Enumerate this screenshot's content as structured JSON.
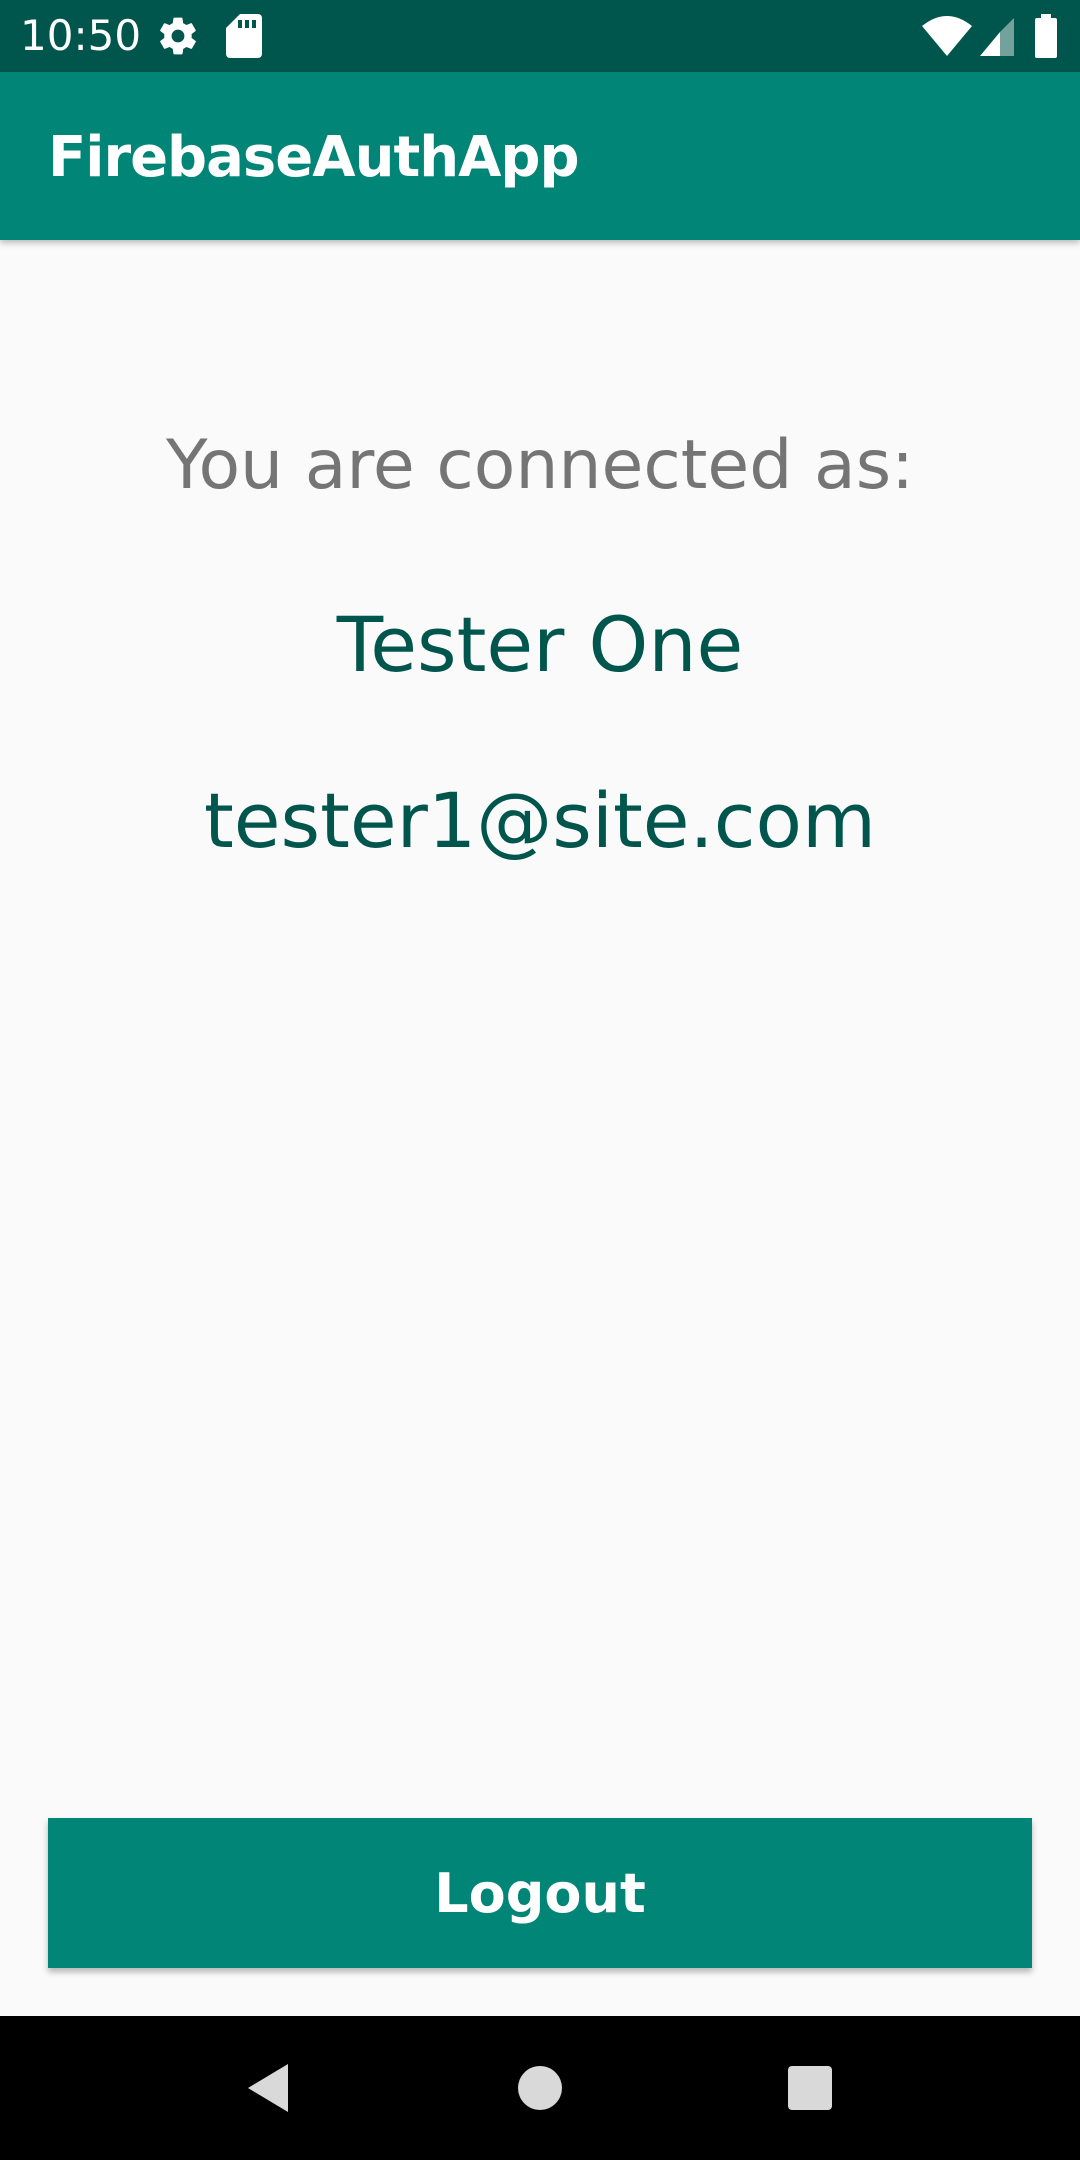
{
  "status_bar": {
    "time": "10:50",
    "icons": [
      "gear-icon",
      "sd-card-icon",
      "wifi-icon",
      "cell-signal-icon",
      "battery-icon"
    ]
  },
  "app_bar": {
    "title": "FirebaseAuthApp"
  },
  "profile": {
    "connected_label": "You are connected as:",
    "name": "Tester One",
    "email": "tester1@site.com"
  },
  "actions": {
    "logout_label": "Logout"
  },
  "navigation": {
    "buttons": [
      "back-icon",
      "home-icon",
      "recents-icon"
    ]
  },
  "colors": {
    "primary": "#008577",
    "primary_dark": "#00564d",
    "text_secondary": "#757575",
    "background": "#fafafa"
  }
}
